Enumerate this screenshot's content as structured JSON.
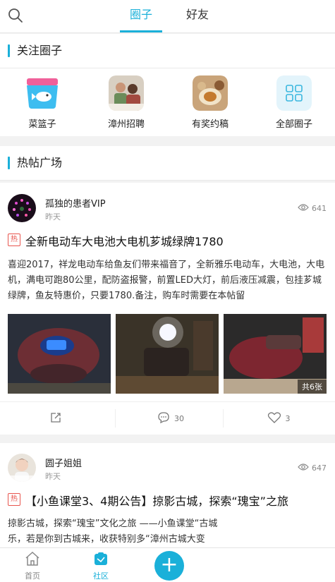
{
  "header": {
    "tabs": [
      {
        "label": "圈子",
        "active": true
      },
      {
        "label": "好友",
        "active": false
      }
    ]
  },
  "followed": {
    "title": "关注圈子",
    "items": [
      {
        "label": "菜篮子",
        "icon": "basket-fish-icon"
      },
      {
        "label": "漳州招聘",
        "icon": "recruit-photo-icon"
      },
      {
        "label": "有奖约稿",
        "icon": "reward-photo-icon"
      },
      {
        "label": "全部圈子",
        "icon": "grid-icon"
      }
    ]
  },
  "hot": {
    "title": "热帖广场"
  },
  "posts": [
    {
      "author": "孤独的患者VIP",
      "time": "昨天",
      "views": "641",
      "hot_label": "热",
      "title": "全新电动车大电池大电机芗城绿牌1780",
      "body": "喜迎2017，祥龙电动车给鱼友们带来福音了，全新雅乐电动车，大电池，大电机，满电可跑80公里，配防盗报警，前置LED大灯，前后液压减震，包挂芗城绿牌，鱼友特惠价，只要1780.备注，购车时需要在本帖留",
      "photo_count": "共6张",
      "comments": "30",
      "likes": "3"
    },
    {
      "author": "圆子姐姐",
      "time": "昨天",
      "views": "647",
      "hot_label": "热",
      "title": "【小鱼课堂3、4期公告】掠影古城，探索“瑰宝”之旅",
      "body": "掠影古城，探索“瑰宝”文化之旅 ——小鱼课堂“古城乐，若是你到古城来，收获特别多“漳州古城大变"
    }
  ],
  "bottom_nav": {
    "home": "首页",
    "community": "社区"
  },
  "colors": {
    "accent": "#1ab0d9",
    "hot": "#e8554e"
  }
}
